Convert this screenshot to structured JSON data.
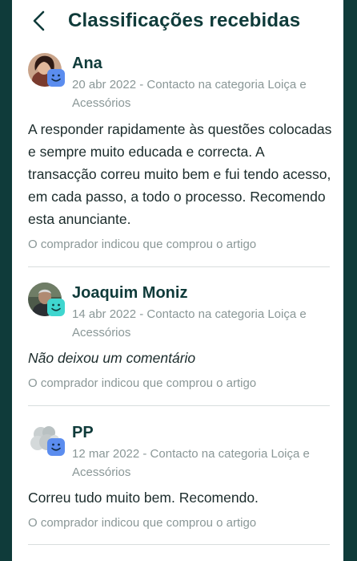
{
  "header": {
    "title": "Classificações recebidas"
  },
  "reviews": [
    {
      "name": "Ana",
      "meta": "20 abr 2022 - Contacto na categoria Loiça e Acessórios",
      "comment": "A responder rapidamente às questões colocadas e sempre muito educada e correcta. A transacção correu muito bem e fui tendo acesso, em cada passo, a todo o processo. Recomendo esta anunciante.",
      "buyer_note": "O comprador indicou que comprou o artigo",
      "badge_color": "#5b8def"
    },
    {
      "name": "Joaquim Moniz",
      "meta": "14 abr 2022 - Contacto na categoria Loiça e Acessórios",
      "comment": "Não deixou um comentário",
      "buyer_note": "O comprador indicou que comprou o artigo",
      "badge_color": "#3fd6cf"
    },
    {
      "name": "PP",
      "meta": "12 mar 2022 - Contacto na categoria Loiça e Acessórios",
      "comment": "Correu tudo muito bem. Recomendo.",
      "buyer_note": "O comprador indicou que comprou o artigo",
      "badge_color": "#5b8def"
    }
  ],
  "colors": {
    "brand_dark": "#0f3b3a",
    "meta_gray": "#8a9797"
  }
}
